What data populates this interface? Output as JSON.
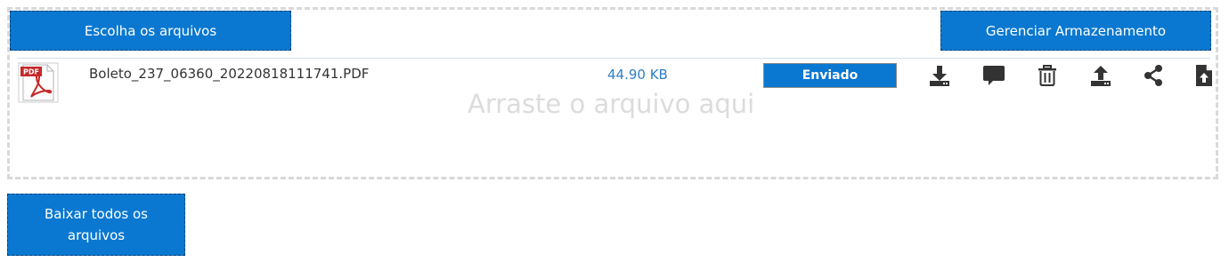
{
  "buttons": {
    "choose_files": "Escolha os arquivos",
    "manage_storage": "Gerenciar Armazenamento",
    "download_all": "Baixar todos os arquivos"
  },
  "dropzone": {
    "hint": "Arraste o arquivo aqui"
  },
  "file": {
    "icon": "pdf-file-icon",
    "icon_label": "PDF",
    "name": "Boleto_237_06360_20220818111741.PDF",
    "size": "44.90 KB",
    "status": "Enviado"
  },
  "actions": [
    "download-icon",
    "comment-icon",
    "trash-icon",
    "upload-icon",
    "share-icon",
    "file-upload-icon"
  ],
  "colors": {
    "accent": "#0a78d0",
    "size_text": "#2f7fc8",
    "icon": "#333333"
  }
}
